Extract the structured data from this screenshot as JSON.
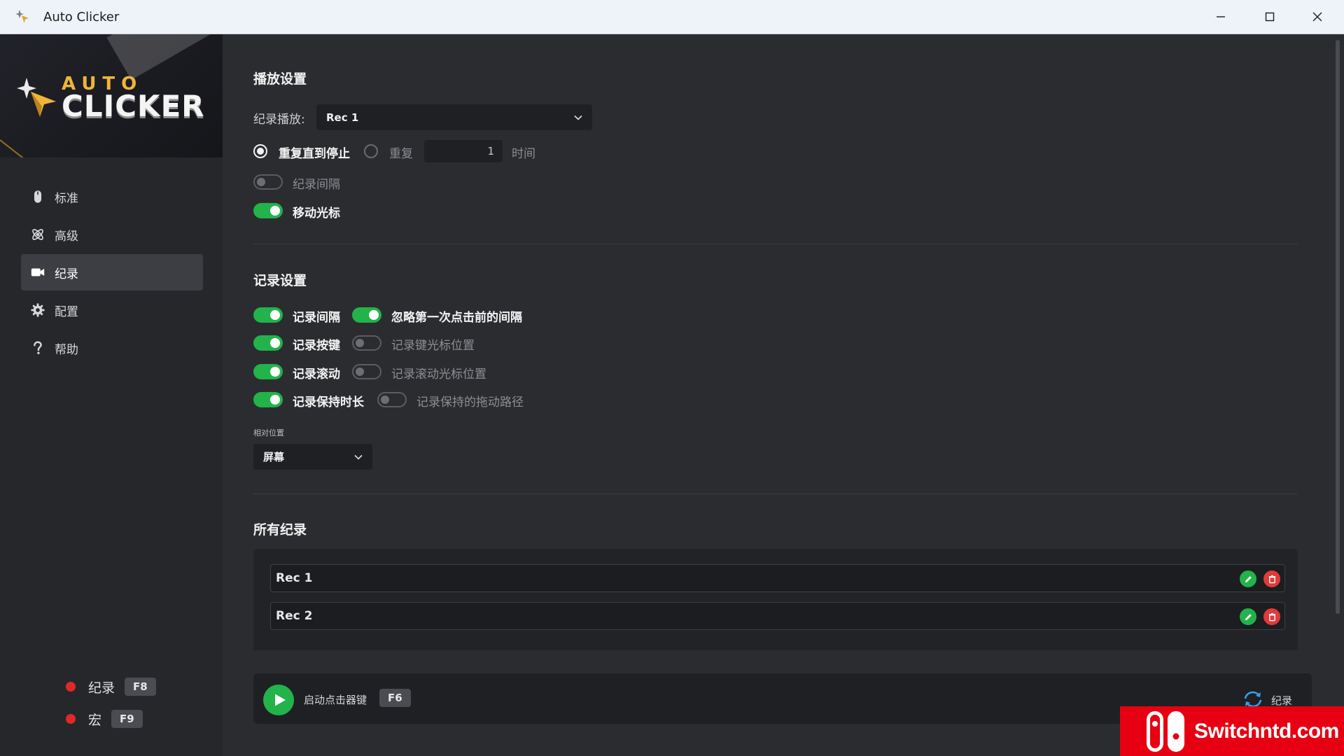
{
  "window": {
    "title": "Auto Clicker",
    "controls": [
      "minimize",
      "maximize",
      "close"
    ]
  },
  "logo": {
    "line1": "AUTO",
    "line2": "CLICKER"
  },
  "sidebar": {
    "items": [
      {
        "label": "标准",
        "icon": "mouse-icon",
        "active": false
      },
      {
        "label": "高级",
        "icon": "atom-icon",
        "active": false
      },
      {
        "label": "纪录",
        "icon": "camera-icon",
        "active": true
      },
      {
        "label": "配置",
        "icon": "gear-icon",
        "active": false
      },
      {
        "label": "帮助",
        "icon": "question-icon",
        "active": false
      }
    ],
    "hotkeys": [
      {
        "label": "纪录",
        "key": "F8"
      },
      {
        "label": "宏",
        "key": "F9"
      }
    ]
  },
  "playback": {
    "title": "播放设置",
    "record_label": "纪录播放:",
    "record_value": "Rec 1",
    "repeat_until_stop": "重复直到停止",
    "repeat": "重复",
    "repeat_count": "1",
    "times": "时间",
    "record_interval": {
      "label": "纪录间隔",
      "on": false
    },
    "move_cursor": {
      "label": "移动光标",
      "on": true
    }
  },
  "recording": {
    "title": "记录设置",
    "options": [
      {
        "label": "记录间隔",
        "on": true
      },
      {
        "label": "忽略第一次点击前的间隔",
        "on": true
      },
      {
        "label": "记录按键",
        "on": true
      },
      {
        "label": "记录键光标位置",
        "on": false
      },
      {
        "label": "记录滚动",
        "on": true
      },
      {
        "label": "记录滚动光标位置",
        "on": false
      },
      {
        "label": "记录保持时长",
        "on": true
      },
      {
        "label": "记录保持的拖动路径",
        "on": false
      }
    ],
    "relative_label": "相对位置",
    "relative_value": "屏幕"
  },
  "all_records": {
    "title": "所有纪录",
    "items": [
      "Rec 1",
      "Rec 2"
    ]
  },
  "bottom": {
    "start_label": "启动点击器键",
    "start_key": "F6",
    "sync_label": "纪录"
  },
  "watermark": {
    "text": "Switchntd.com"
  },
  "colors": {
    "accent_green": "#22b34a",
    "danger_red": "#e23a3a",
    "logo_gold": "#f0b43a",
    "background": "#2b2c30",
    "sidebar": "#26272b"
  }
}
